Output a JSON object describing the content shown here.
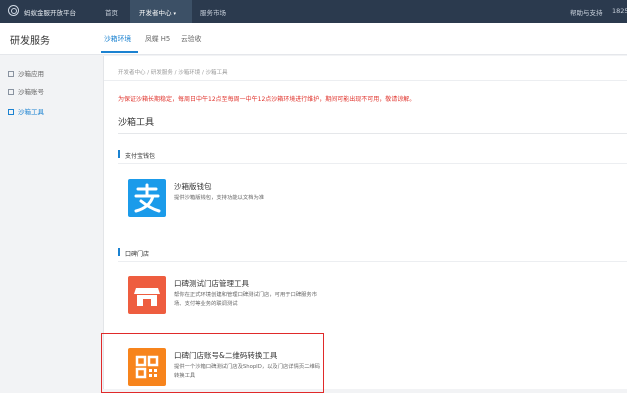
{
  "topbar": {
    "brand": "蚂蚁金服开放平台",
    "nav": [
      "首页",
      "开发者中心",
      "服务市场"
    ],
    "dev_caret": "▾",
    "help": "帮助与支持",
    "phone": "1825"
  },
  "header": {
    "title": "研发服务",
    "tabs": [
      "沙箱环境",
      "凤蝶 H5",
      "云验收"
    ]
  },
  "sidebar": {
    "items": [
      "沙箱应用",
      "沙箱账号",
      "沙箱工具"
    ]
  },
  "main": {
    "breadcrumb": "开发者中心 / 研发服务 / 沙箱环境 / 沙箱工具",
    "notice": "为保证沙箱长期稳定，每周日中午12点至每周一中午12点沙箱环境进行维护，期间可能出现不可用，敬请谅解。",
    "heading": "沙箱工具",
    "sections": [
      {
        "title": "支付宝钱包",
        "cards": [
          {
            "title": "沙箱版钱包",
            "desc": "提供沙箱版钱包，支持功能以文档为准",
            "icon": "alipay-icon"
          }
        ]
      },
      {
        "title": "口碑门店",
        "cards": [
          {
            "title": "口碑测试门店管理工具",
            "desc": "帮你在正式环境创建和管理口碑测试门店，可用于口碑服务市场、支付等业务的联调测试",
            "icon": "store-icon"
          },
          {
            "title": "口碑门店账号&二维码转换工具",
            "desc": "提供一个沙箱口碑测试门店及ShopID，以及门店详情页二维码转换工具",
            "icon": "qrcode-icon"
          }
        ]
      }
    ]
  },
  "colors": {
    "accent": "#1b82d1",
    "topbar": "#2b3a4e",
    "notice": "#e0322b",
    "highlight": "#e02a2a"
  }
}
